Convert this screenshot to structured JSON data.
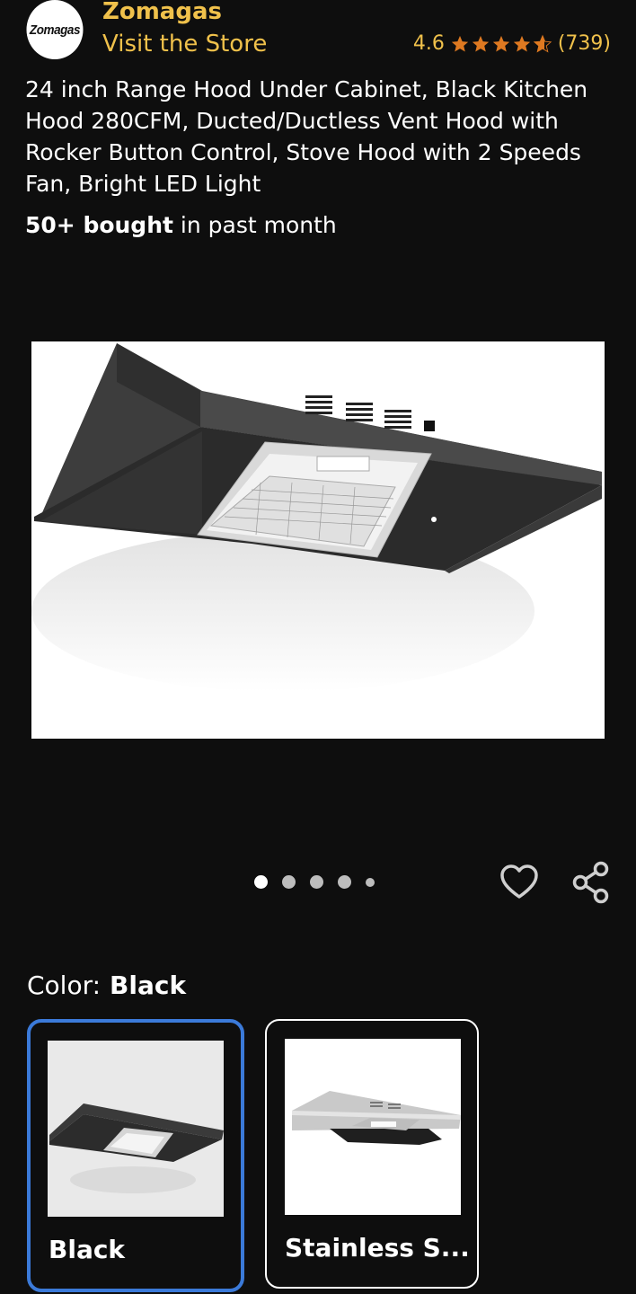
{
  "header": {
    "logo_text": "Zomagas",
    "brand": "Zomagas",
    "visit_store": "Visit the Store",
    "rating": "4.6",
    "review_count": "(739)",
    "stars_value": 4.6
  },
  "product": {
    "title": "24 inch Range Hood Under Cabinet, Black Kitchen Hood 280CFM, Ducted/Ductless Vent Hood with Rocker Button Control, Stove Hood with 2 Speeds Fan, Bright LED Light",
    "bought_bold": "50+ bought",
    "bought_rest": " in past month"
  },
  "gallery": {
    "dots": 5,
    "active_index": 0
  },
  "color": {
    "label": "Color:",
    "selected": "Black",
    "options": [
      {
        "label": "Black",
        "selected": true
      },
      {
        "label": "Stainless S...",
        "selected": false
      }
    ]
  },
  "colors": {
    "background": "#0e0e0e",
    "accent": "#f0c14b",
    "star": "#de7921",
    "selected_border": "#3b7ad9"
  },
  "icons": [
    "heart-icon",
    "share-icon",
    "star-icon"
  ]
}
